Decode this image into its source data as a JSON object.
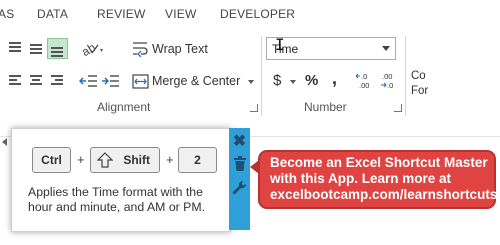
{
  "ribbon": {
    "tabs": [
      "AS",
      "DATA",
      "REVIEW",
      "VIEW",
      "DEVELOPER"
    ],
    "alignment": {
      "wrap_text": "Wrap Text",
      "merge_center": "Merge & Center",
      "group_label": "Alignment"
    },
    "number": {
      "format_value": "Time",
      "currency": "$",
      "percent": "%",
      "comma": ",",
      "increase_decimal": "←.0\n.00",
      "decrease_decimal": ".00\n→.0",
      "group_label": "Number"
    },
    "next_group_partial": [
      "Co",
      "For"
    ]
  },
  "shortcut_popup": {
    "keys": [
      "Ctrl",
      "Shift",
      "2"
    ],
    "plus": "+",
    "description": "Applies the Time format with the hour and minute, and AM or PM.",
    "side_icons": [
      "close-icon",
      "trash-icon",
      "wrench-icon"
    ]
  },
  "callout": {
    "lines": [
      "Become an Excel Shortcut Master",
      "with this App. Learn more at",
      "excelbootcamp.com/learnshortcuts"
    ],
    "color": "#e04442"
  },
  "colors": {
    "accent_green": "#c6e6cf",
    "sidebar_blue": "#2f9fd8"
  }
}
